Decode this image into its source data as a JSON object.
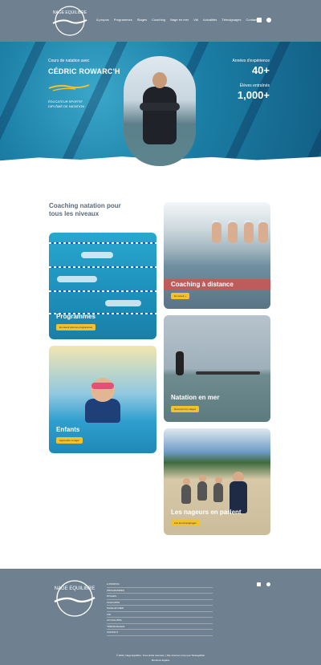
{
  "header": {
    "logo_text": "NAGE EQUILIBRE",
    "nav": [
      "A propos",
      "Programmes",
      "Stages",
      "Coaching",
      "Nage en mer",
      "Vid",
      "Actualités",
      "Témoignages",
      "Contact"
    ]
  },
  "hero": {
    "kicker": "Cours de natation avec",
    "name": "CÉDRIC ROWARC'H",
    "role": "ÉDUCATEUR SPORTIF DIPLÔMÉ DE NATATION",
    "stats": [
      {
        "label": "Années d'expérience",
        "value": "40+"
      },
      {
        "label": "Élèves entraînés",
        "value": "1,000+"
      }
    ]
  },
  "coaching": {
    "title": "Coaching natation pour tous les niveaux",
    "cards": [
      {
        "title": "Coaching à distance",
        "button": "En savoir +"
      },
      {
        "title": "Programmes",
        "button": "En savoir plus les programmes"
      },
      {
        "title": "Natation en mer",
        "button": "Découvrir les stages"
      },
      {
        "title": "Enfants",
        "button": "Apprendre à nager"
      },
      {
        "title": "Les nageurs en parlent",
        "button": "Lire les témoignages"
      }
    ]
  },
  "footer": {
    "logo_text": "NAGE EQUILIBRE",
    "links": [
      "A PROPOS",
      "PROGRAMMES",
      "STAGES",
      "COACHING",
      "NAGE EN MER",
      "VID",
      "ACTUALITÉS",
      "TÉMOIGNAGES",
      "CONTACT"
    ],
    "copyright": "© 2022, Nage Equilibre. Tous droits réservés. | Site internet conçu par StrategiWeb",
    "credit": "Mentions légales"
  },
  "colors": {
    "header": "#6f8190",
    "accent": "#f2c12e"
  }
}
